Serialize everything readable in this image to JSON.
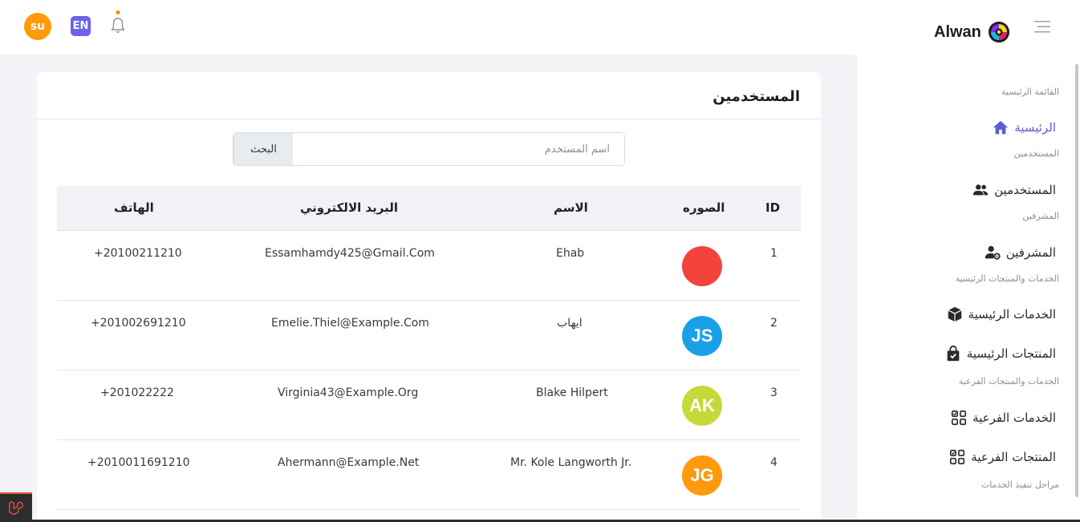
{
  "header": {
    "user_initials": "su",
    "language": "EN",
    "brand": "Alwan"
  },
  "sidebar": {
    "sections": [
      "القائمة الرئيسية",
      "المستخدمين",
      "المشرفين",
      "الخدمات والمنتجات الرئيسية",
      "الخدمات والمنتجات الفرعية",
      "مراحل تنفيذ الخدمات"
    ],
    "items": [
      {
        "label": "الرئيسية",
        "icon": "home-icon"
      },
      {
        "label": "المستخدمين",
        "icon": "users-icon"
      },
      {
        "label": "المشرفين",
        "icon": "user-gear-icon"
      },
      {
        "label": "الخدمات الرئيسية",
        "icon": "box-icon"
      },
      {
        "label": "المنتجات الرئيسية",
        "icon": "bag-check-icon"
      },
      {
        "label": "الخدمات الفرعية",
        "icon": "grid-check-icon"
      },
      {
        "label": "المنتجات الفرعية",
        "icon": "grid-check-icon"
      }
    ],
    "accent_color": "#5f5bd6"
  },
  "main": {
    "title": "المستخدمين",
    "search": {
      "placeholder": "اسم المستخدم",
      "button_label": "البحث"
    },
    "table": {
      "columns": [
        "ID",
        "الصوره",
        "الاسم",
        "البريد الالكتروني",
        "الهاتف"
      ],
      "rows": [
        {
          "id": "1",
          "avatar_initials": "",
          "avatar_color": "#f4433c",
          "name": "Ehab",
          "email": "Essamhamdy425@Gmail.Com",
          "phone": "+20100211210"
        },
        {
          "id": "2",
          "avatar_initials": "JS",
          "avatar_color": "#1aa0e8",
          "name": "ايهاب",
          "email": "Emelie.Thiel@Example.Com",
          "phone": "+201002691210"
        },
        {
          "id": "3",
          "avatar_initials": "AK",
          "avatar_color": "#c5d93a",
          "name": "Blake Hilpert",
          "email": "Virginia43@Example.Org",
          "phone": "+201022222"
        },
        {
          "id": "4",
          "avatar_initials": "JG",
          "avatar_color": "#ff9a0d",
          "name": "Mr. Kole Langworth Jr.",
          "email": "Ahermann@Example.Net",
          "phone": "+2010011691210"
        }
      ]
    }
  }
}
